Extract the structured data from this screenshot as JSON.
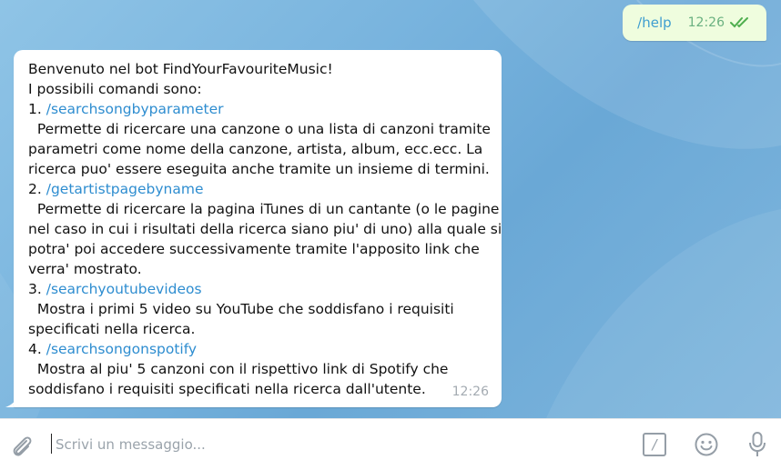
{
  "outgoing": {
    "text": "/help",
    "time": "12:26",
    "status_icon": "double-check-icon"
  },
  "incoming": {
    "lines": [
      {
        "text": "Benvenuto nel bot FindYourFavouriteMusic!",
        "link": false
      },
      {
        "text": "I possibili comandi sono:",
        "link": false
      },
      {
        "prefix": "1. ",
        "text": "/searchsongbyparameter",
        "link": true
      },
      {
        "text": "  Permette di ricercare una canzone o una lista di canzoni tramite",
        "link": false
      },
      {
        "text": "parametri come nome della canzone, artista, album, ecc.ecc. La",
        "link": false
      },
      {
        "text": "ricerca puo' essere eseguita anche tramite un insieme di termini.",
        "link": false
      },
      {
        "prefix": "2. ",
        "text": "/getartistpagebyname",
        "link": true
      },
      {
        "text": "  Permette di ricercare la pagina iTunes di un cantante (o le pagine",
        "link": false
      },
      {
        "text": "nel caso in cui i risultati della ricerca siano piu' di uno) alla quale si",
        "link": false
      },
      {
        "text": "potra' poi accedere successivamente tramite l'apposito link che",
        "link": false
      },
      {
        "text": "verra' mostrato.",
        "link": false
      },
      {
        "prefix": "3. ",
        "text": "/searchyoutubevideos",
        "link": true
      },
      {
        "text": "  Mostra i primi 5 video su YouTube che soddisfano i requisiti",
        "link": false
      },
      {
        "text": "specificati nella ricerca.",
        "link": false
      },
      {
        "prefix": "4. ",
        "text": "/searchsongonspotify",
        "link": true
      },
      {
        "text": "  Mostra al piu' 5 canzoni con il rispettivo link di Spotify che",
        "link": false
      },
      {
        "text": "soddisfano i requisiti specificati nella ricerca dall'utente.",
        "link": false
      }
    ],
    "time": "12:26"
  },
  "composer": {
    "placeholder": "Scrivi un messaggio...",
    "value": "",
    "attach_icon": "paperclip-icon",
    "commands_icon": "slash-command-icon",
    "commands_glyph": "/",
    "emoji_icon": "smiley-icon",
    "mic_icon": "microphone-icon"
  },
  "colors": {
    "outgoing_bubble": "#effdde",
    "incoming_bubble": "#ffffff",
    "link": "#2e8dd0",
    "check": "#4fae4e"
  }
}
